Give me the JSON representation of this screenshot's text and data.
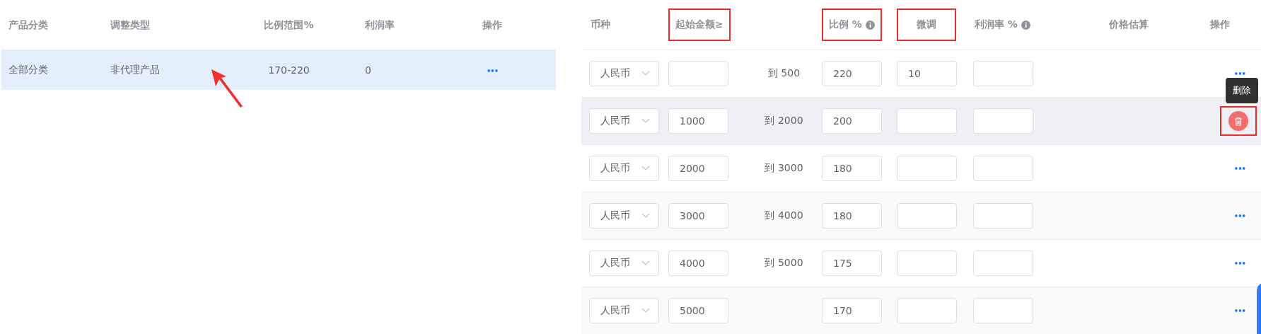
{
  "left_table": {
    "columns": [
      "产品分类",
      "调整类型",
      "比例范围%",
      "利润率",
      "操作"
    ],
    "rows": [
      {
        "category": "全部分类",
        "type": "非代理产品",
        "range": "170-220",
        "profit": "0",
        "action": "•••",
        "selected": true
      }
    ]
  },
  "right_table": {
    "columns": [
      {
        "label": "币种",
        "highlighted": false,
        "info": false
      },
      {
        "label": "起始金额≥",
        "highlighted": true,
        "info": false
      },
      {
        "label": "比例 %",
        "highlighted": true,
        "info": true
      },
      {
        "label": "微调",
        "highlighted": true,
        "info": false
      },
      {
        "label": "利润率 %",
        "highlighted": false,
        "info": true
      },
      {
        "label": "价格估算",
        "highlighted": false,
        "info": false
      },
      {
        "label": "操作",
        "highlighted": false,
        "info": false
      }
    ],
    "rows": [
      {
        "currency": "人民币",
        "start": "",
        "to": "到 500",
        "ratio": "220",
        "adjust": "10",
        "profit": "",
        "action": {
          "kind": "more",
          "text": "•••"
        },
        "hovered": false
      },
      {
        "currency": "人民币",
        "start": "1000",
        "to": "到 2000",
        "ratio": "200",
        "adjust": "",
        "profit": "",
        "action": {
          "kind": "delete",
          "tooltip": "删除"
        },
        "hovered": true
      },
      {
        "currency": "人民币",
        "start": "2000",
        "to": "到 3000",
        "ratio": "180",
        "adjust": "",
        "profit": "",
        "action": {
          "kind": "more",
          "text": "•••"
        },
        "hovered": false
      },
      {
        "currency": "人民币",
        "start": "3000",
        "to": "到 4000",
        "ratio": "180",
        "adjust": "",
        "profit": "",
        "action": {
          "kind": "more",
          "text": "•••"
        },
        "hovered": false
      },
      {
        "currency": "人民币",
        "start": "4000",
        "to": "到 5000",
        "ratio": "175",
        "adjust": "",
        "profit": "",
        "action": {
          "kind": "more",
          "text": "•••"
        },
        "hovered": false
      },
      {
        "currency": "人民币",
        "start": "5000",
        "to": "",
        "ratio": "170",
        "adjust": "",
        "profit": "",
        "action": {
          "kind": "more",
          "text": "•••"
        },
        "hovered": false
      }
    ]
  }
}
